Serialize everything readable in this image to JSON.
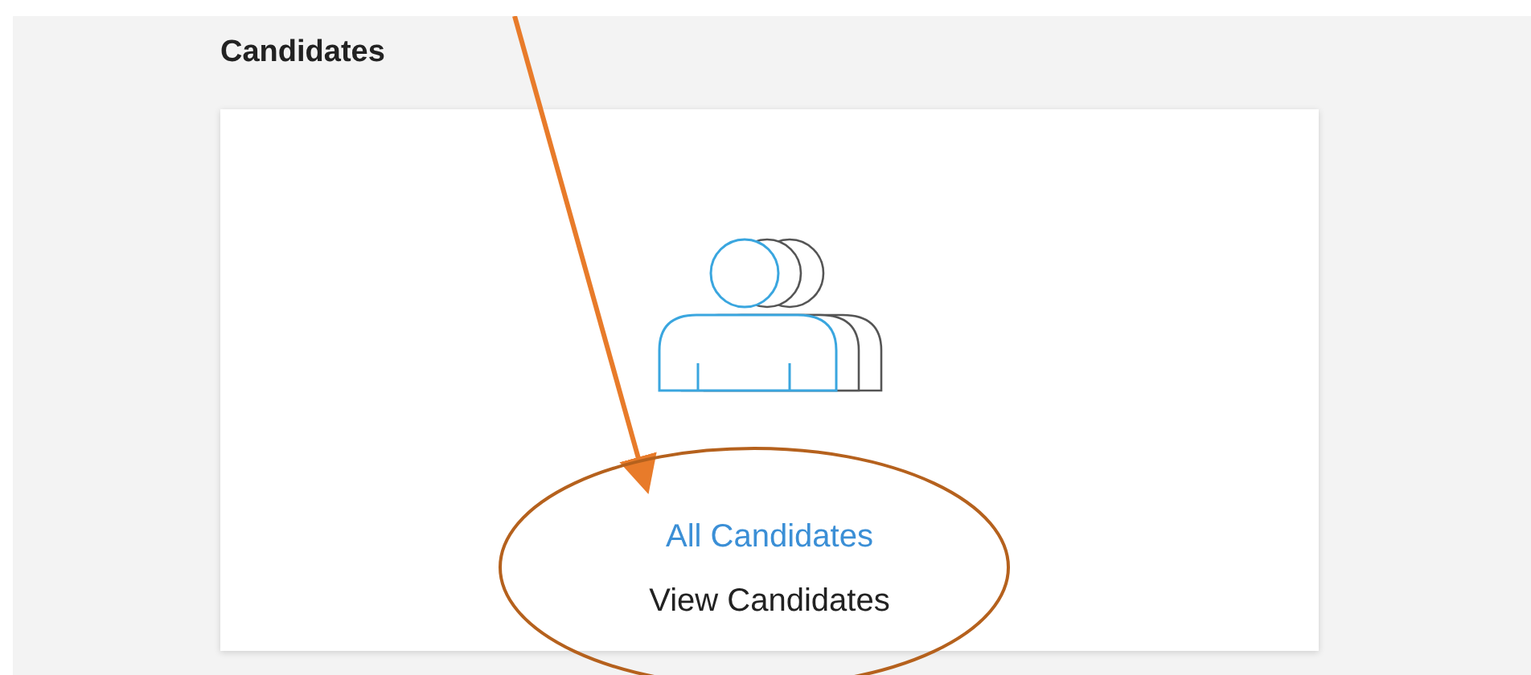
{
  "section": {
    "title": "Candidates"
  },
  "card": {
    "link": "All Candidates",
    "description": "View Candidates"
  }
}
